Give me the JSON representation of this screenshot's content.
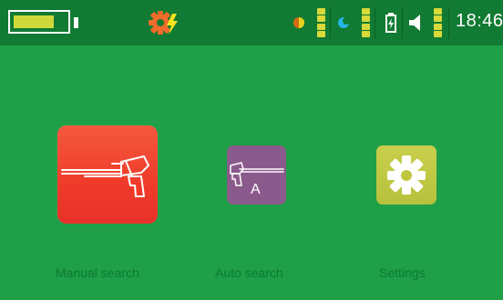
{
  "status": {
    "battery_level": 0.78,
    "time": "18:46",
    "indicators": [
      {
        "name": "sensitivity-icon",
        "level": 4
      },
      {
        "name": "discrimination-icon",
        "level": 4
      },
      {
        "name": "device-battery-icon",
        "level": 4
      },
      {
        "name": "volume-icon",
        "level": 4
      }
    ]
  },
  "menu": {
    "manual_search": "Manual search",
    "auto_search": "Auto search",
    "settings": "Settings",
    "auto_badge": "A"
  },
  "colors": {
    "background": "#1f9f47",
    "status_bar": "#117a33",
    "manual_tile": "#f24a34",
    "auto_tile": "#8b5a8c",
    "settings_tile": "#c2c944",
    "level_on": "#d9d93a",
    "label": "#0b7a33"
  }
}
